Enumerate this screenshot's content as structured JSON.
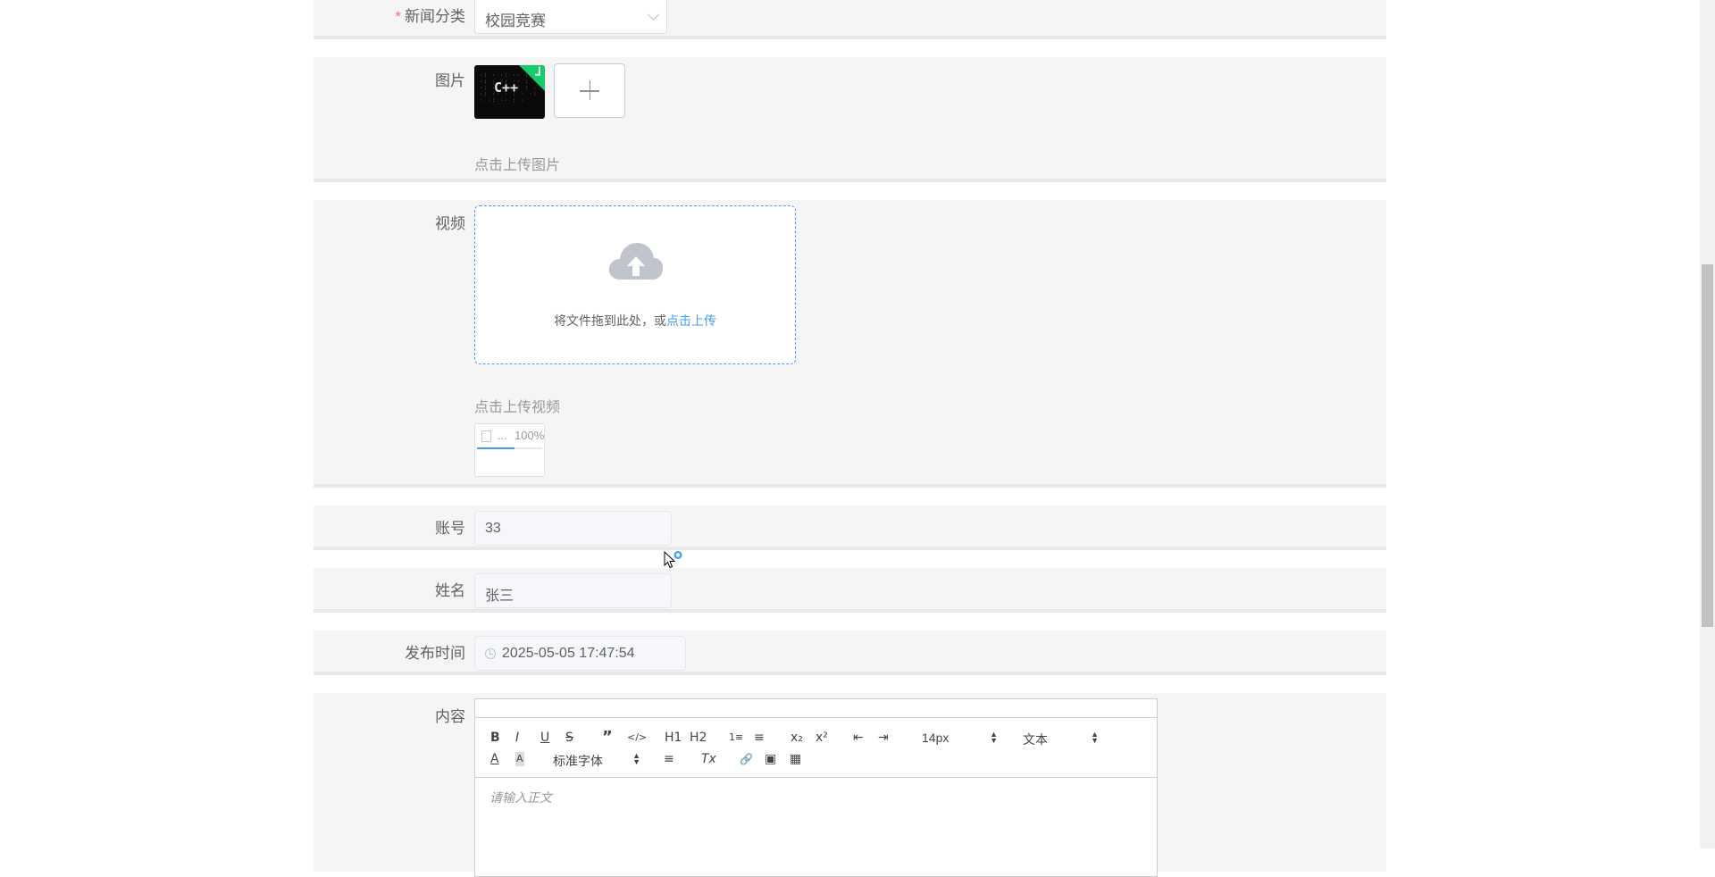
{
  "category": {
    "required_mark": "*",
    "label": "新闻分类",
    "value": "校园竞赛"
  },
  "image": {
    "label": "图片",
    "tip": "点击上传图片",
    "thumb_text": "C++"
  },
  "video": {
    "label": "视频",
    "drop_text": "将文件拖到此处，或",
    "drop_link": "点击上传",
    "tip": "点击上传视频",
    "file": {
      "name": "...",
      "progress_text": "100%",
      "progress": 100
    }
  },
  "account": {
    "label": "账号",
    "value": "33"
  },
  "name": {
    "label": "姓名",
    "value": "张三"
  },
  "publish_time": {
    "label": "发布时间",
    "value": "2025-05-05 17:47:54"
  },
  "content": {
    "label": "内容",
    "toolbar": {
      "bold": "B",
      "italic": "I",
      "underline": "U",
      "strike": "S",
      "quote": "”",
      "code": "</>",
      "h1": "H1",
      "h2": "H2",
      "ordered_list": "1≡",
      "bullet_list": "≡",
      "sub": "x₂",
      "sup": "x²",
      "outdent": "⇤",
      "indent": "⇥",
      "size": "14px",
      "header": "文本",
      "color": "A",
      "background": "A",
      "font": "标准字体",
      "align": "≡",
      "clean": "Tx",
      "link": "🔗",
      "image": "▣",
      "video": "▦"
    },
    "placeholder": "请输入正文"
  }
}
